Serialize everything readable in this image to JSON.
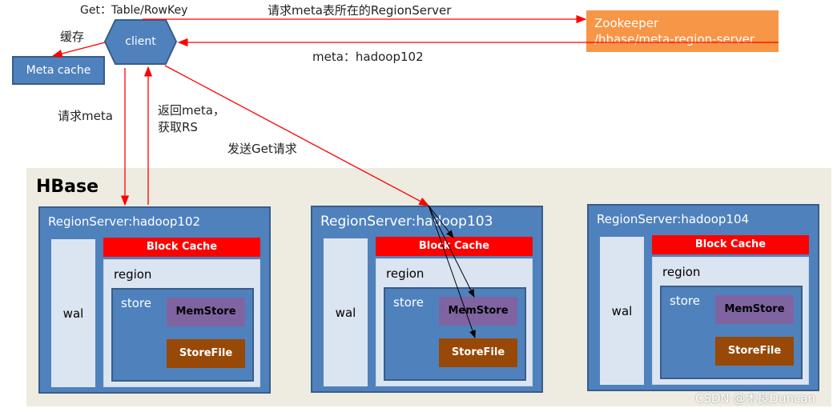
{
  "client": {
    "label": "client"
  },
  "meta_cache": {
    "label": "Meta cache"
  },
  "zookeeper": {
    "line1": "Zookeeper",
    "line2": "/hbase/meta-region-server"
  },
  "labels": {
    "get_request": "Get：Table/RowKey",
    "cache": "缓存",
    "request_meta_rs": "请求meta表所在的RegionServer",
    "meta_response": "meta：hadoop102",
    "request_meta": "请求meta",
    "return_meta_1": "返回meta，",
    "return_meta_2": "获取RS",
    "send_get": "发送Get请求"
  },
  "hbase": {
    "title": "HBase"
  },
  "region_servers": [
    {
      "title": "RegionServer:hadoop102",
      "wal": "wal",
      "block_cache": "Block Cache",
      "region": "region",
      "store": "store",
      "memstore": "MemStore",
      "storefile": "StoreFile"
    },
    {
      "title": "RegionServer:hadoop103",
      "wal": "wal",
      "block_cache": "Block Cache",
      "region": "region",
      "store": "store",
      "memstore": "MemStore",
      "storefile": "StoreFile"
    },
    {
      "title": "RegionServer:hadoop104",
      "wal": "wal",
      "block_cache": "Block Cache",
      "region": "region",
      "store": "store",
      "memstore": "MemStore",
      "storefile": "StoreFile"
    }
  ],
  "watermark": "CSDN @木良Duncan",
  "colors": {
    "node": "#4f81bd",
    "zookeeper": "#f79646",
    "block_cache": "#ff0000",
    "memstore": "#8064a2",
    "storefile": "#984807",
    "arrow": "#ff0000",
    "hbase_bg": "#eeece1"
  }
}
